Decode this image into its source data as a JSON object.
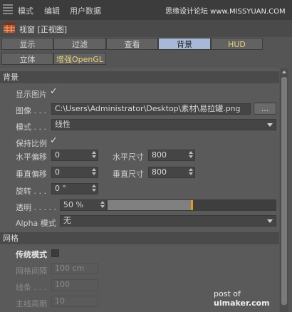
{
  "menubar": {
    "items": [
      "模式",
      "编辑",
      "用户数据"
    ],
    "watermark": "思缘设计论坛 www.MISSYUAN.COM"
  },
  "window": {
    "title": "视窗 [正视图]"
  },
  "tabs": {
    "row1": [
      "显示",
      "过滤",
      "查看",
      "背景",
      "HUD"
    ],
    "row2": [
      "立体",
      "增强OpenGL"
    ],
    "active": "背景"
  },
  "background": {
    "section": "背景",
    "show_image": {
      "label": "显示图片",
      "checked": true
    },
    "image": {
      "label": "图像 . . .",
      "value": "C:\\Users\\Administrator\\Desktop\\素材\\易拉罐.png",
      "button": "..."
    },
    "mode": {
      "label": "模式 . . .",
      "value": "线性"
    },
    "keep_ratio": {
      "label": "保持比例",
      "checked": true
    },
    "h_offset": {
      "label": "水平偏移",
      "value": "0"
    },
    "h_size": {
      "label": "水平尺寸",
      "value": "800"
    },
    "v_offset": {
      "label": "垂直偏移",
      "value": "0"
    },
    "v_size": {
      "label": "垂直尺寸",
      "value": "800"
    },
    "rotation": {
      "label": "旋转 . . .",
      "value": "0 °"
    },
    "transparency": {
      "label": "透明 . . . . .",
      "value": "50 %",
      "level": 0.5
    },
    "alpha_mode": {
      "label": "Alpha 模式",
      "value": "无"
    }
  },
  "grid": {
    "section": "网格",
    "classic_mode": {
      "label": "传统模式",
      "checked": false
    },
    "spacing": {
      "label": "网格间隔",
      "value": "100 cm"
    },
    "lines": {
      "label": "线条 . . .",
      "value": "100"
    },
    "major": {
      "label": "主线周期",
      "value": "10"
    }
  },
  "watermark_bottom": {
    "prefix": "post of ",
    "site": "uimaker.com"
  },
  "colors": {
    "active_tab": "#a8b8d8",
    "accent": "#e89a1c",
    "highlight_text": "#e8d27a"
  }
}
